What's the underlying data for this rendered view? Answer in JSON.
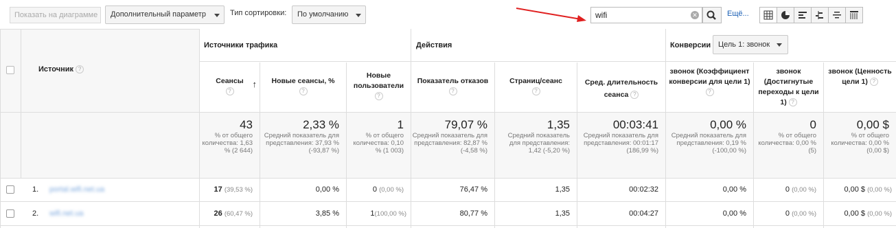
{
  "toolbar": {
    "show_chart_label": "Показать на диаграмме",
    "extra_param_label": "Дополнительный параметр",
    "sort_type_label": "Тип сортировки:",
    "sort_value": "По умолчанию",
    "search_value": "wifi",
    "more_label": "Ещё..."
  },
  "table": {
    "source_header": "Источник",
    "groups": {
      "traffic": "Источники трафика",
      "actions": "Действия",
      "conversions": "Конверсии",
      "goal_select": "Цель 1: звонок"
    },
    "columns": [
      {
        "label": "Сеансы"
      },
      {
        "label": "Новые сеансы, %"
      },
      {
        "label": "Новые пользователи"
      },
      {
        "label": "Показатель отказов"
      },
      {
        "label": "Страниц/сеанс"
      },
      {
        "label": "Сред. длительность сеанса"
      },
      {
        "label": "звонок (Коэффициент конверсии для цели 1)"
      },
      {
        "label": "звонок (Достигнутые переходы к цели 1)"
      },
      {
        "label": "звонок (Ценность цели 1)"
      }
    ],
    "totals": [
      {
        "value": "43",
        "sub": "% от общего количества: 1,63 % (2 644)"
      },
      {
        "value": "2,33 %",
        "sub": "Средний показатель для представления: 37,93 % (-93,87 %)"
      },
      {
        "value": "1",
        "sub": "% от общего количества: 0,10 % (1 003)"
      },
      {
        "value": "79,07 %",
        "sub": "Средний показатель для представления: 82,87 % (-4,58 %)"
      },
      {
        "value": "1,35",
        "sub": "Средний показатель для представления: 1,42 (-5,20 %)"
      },
      {
        "value": "00:03:41",
        "sub": "Средний показатель для представления: 00:01:17 (186,99 %)"
      },
      {
        "value": "0,00 %",
        "sub": "Средний показатель для представления: 0,19 % (-100,00 %)"
      },
      {
        "value": "0",
        "sub": "% от общего количества: 0,00 % (5)"
      },
      {
        "value": "0,00 $",
        "sub": "% от общего количества: 0,00 % (0,00 $)"
      }
    ],
    "rows": [
      {
        "num": "1.",
        "source": "portal.wifi.net.ua",
        "cells": [
          {
            "v": "17",
            "p": "(39,53 %)"
          },
          {
            "v": "0,00 %",
            "p": ""
          },
          {
            "v": "0",
            "p": "(0,00 %)"
          },
          {
            "v": "76,47 %",
            "p": ""
          },
          {
            "v": "1,35",
            "p": ""
          },
          {
            "v": "00:02:32",
            "p": ""
          },
          {
            "v": "0,00 %",
            "p": ""
          },
          {
            "v": "0",
            "p": "(0,00 %)"
          },
          {
            "v": "0,00 $",
            "p": "(0,00 %)"
          }
        ]
      },
      {
        "num": "2.",
        "source": "wifi.net.ua",
        "cells": [
          {
            "v": "26",
            "p": "(60,47 %)"
          },
          {
            "v": "3,85 %",
            "p": ""
          },
          {
            "v": "1",
            "p": "(100,00 %)"
          },
          {
            "v": "80,77 %",
            "p": ""
          },
          {
            "v": "1,35",
            "p": ""
          },
          {
            "v": "00:04:27",
            "p": ""
          },
          {
            "v": "0,00 %",
            "p": ""
          },
          {
            "v": "0",
            "p": "(0,00 %)"
          },
          {
            "v": "0,00 $",
            "p": "(0,00 %)"
          }
        ]
      }
    ]
  },
  "colors": {
    "link": "#1a5fb4",
    "arrow": "#e02020",
    "border": "#dddddd"
  }
}
